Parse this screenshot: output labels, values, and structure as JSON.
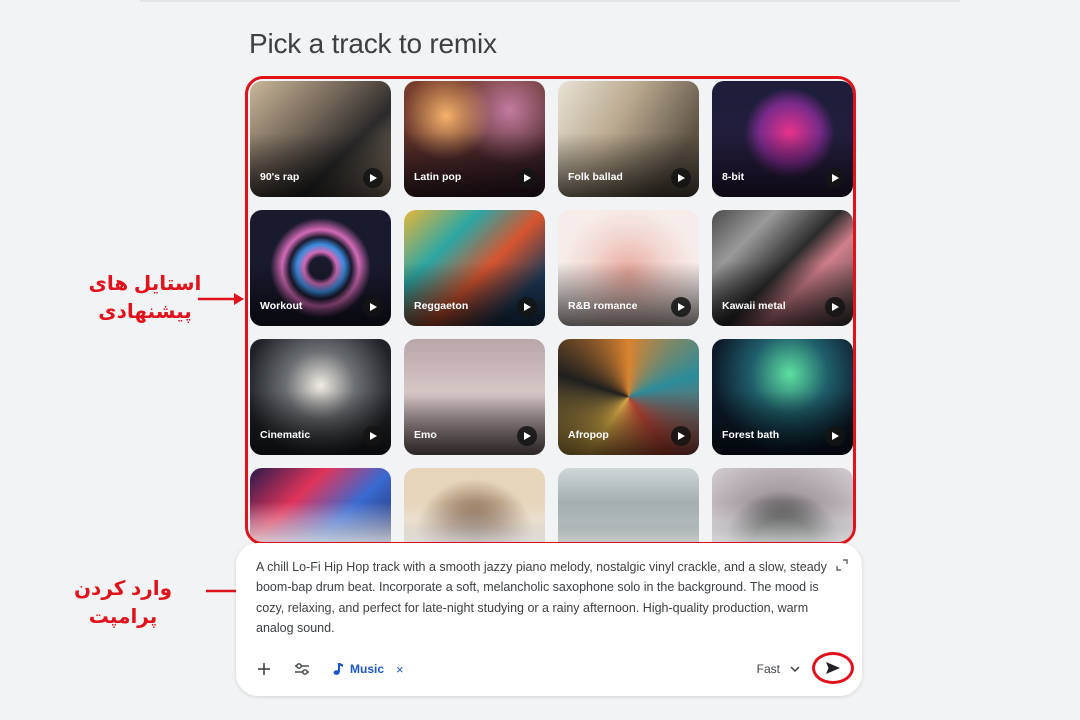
{
  "header": {
    "title": "Pick a track to remix"
  },
  "tracks": [
    {
      "label": "90's rap",
      "theme": "abstract-blocks"
    },
    {
      "label": "Latin pop",
      "theme": "dance-crowd"
    },
    {
      "label": "Folk ballad",
      "theme": "sunlit-window"
    },
    {
      "label": "8-bit",
      "theme": "pixel-arcade"
    },
    {
      "label": "Workout",
      "theme": "neon-swirl"
    },
    {
      "label": "Reggaeton",
      "theme": "speaker-art"
    },
    {
      "label": "R&B romance",
      "theme": "heart-hands"
    },
    {
      "label": "Kawaii metal",
      "theme": "shards"
    },
    {
      "label": "Cinematic",
      "theme": "light-corridor"
    },
    {
      "label": "Emo",
      "theme": "misty"
    },
    {
      "label": "Afropop",
      "theme": "pinwheel"
    },
    {
      "label": "Forest bath",
      "theme": "aurora-forest"
    },
    {
      "label": "",
      "theme": "neon-chevrons"
    },
    {
      "label": "",
      "theme": "stone-sculpture"
    },
    {
      "label": "",
      "theme": "misty-hills"
    },
    {
      "label": "",
      "theme": "bird-speaker"
    }
  ],
  "annotations": {
    "styles": "استایل های پیشنهادی",
    "prompt": "وارد کردن پرامپت"
  },
  "prompt": {
    "text": "A chill Lo-Fi Hip Hop track with a smooth jazzy piano melody, nostalgic vinyl crackle, and a slow, steady boom-bap drum beat. Incorporate a soft, melancholic saxophone solo in the background. The mood is cozy, relaxing, and perfect for late-night studying or a rainy afternoon. High-quality production, warm analog sound.",
    "chip_label": "Music",
    "chip_close": "×",
    "speed": "Fast"
  },
  "colors": {
    "annotation": "#e0121b",
    "chip": "#1a56c8"
  },
  "icons": [
    "play-icon",
    "expand-icon",
    "plus-icon",
    "tune-icon",
    "music-note-icon",
    "close-icon",
    "chevron-down-icon",
    "send-icon"
  ]
}
